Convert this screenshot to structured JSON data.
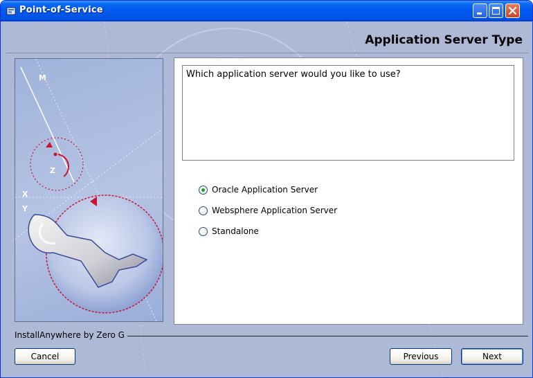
{
  "window": {
    "title": "Point-of-Service"
  },
  "header": {
    "title": "Application Server Type"
  },
  "side_panel": {
    "labels": {
      "m": "M",
      "z": "Z",
      "x": "X",
      "y": "Y"
    }
  },
  "main": {
    "question": "Which application server would you like to use?",
    "options": [
      {
        "label": "Oracle Application Server",
        "checked": true
      },
      {
        "label": "Websphere Application Server",
        "checked": false
      },
      {
        "label": "Standalone",
        "checked": false
      }
    ]
  },
  "footer": {
    "vendor": "InstallAnywhere by Zero G",
    "cancel_label": "Cancel",
    "previous_label": "Previous",
    "next_label": "Next"
  },
  "colors": {
    "titlebar": "#0054e3",
    "window_bg": "#aeb9d6",
    "radio_selected": "#21a121",
    "accent_red": "#d01030"
  },
  "icons": {
    "app": "installer-icon",
    "minimize": "minimize-icon",
    "maximize": "maximize-icon",
    "close": "close-icon",
    "side_art": "wrench-icon"
  }
}
